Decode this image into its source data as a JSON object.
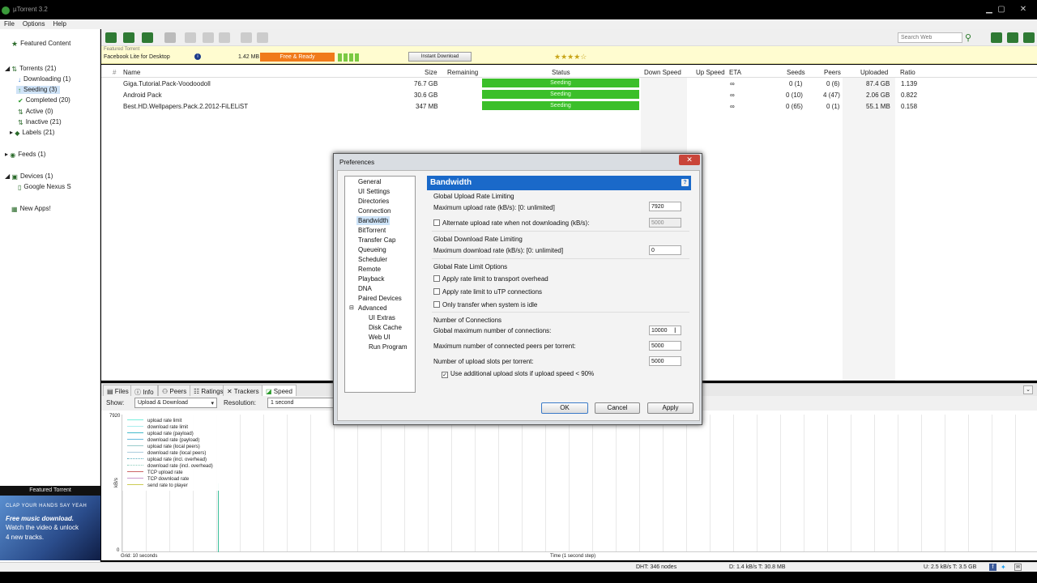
{
  "window": {
    "title": "µTorrent 3.2"
  },
  "menu": [
    "File",
    "Options",
    "Help"
  ],
  "sidebar": {
    "featured": "Featured Content",
    "torrents": "Torrents (21)",
    "items": [
      "Downloading (1)",
      "Seeding (3)",
      "Completed (20)",
      "Active (0)",
      "Inactive (21)",
      "Labels (21)"
    ],
    "feeds": "Feeds (1)",
    "devices": "Devices (1)",
    "device": "Google Nexus S",
    "apps": "New Apps!"
  },
  "toolbar": {
    "search_placeholder": "Search Web"
  },
  "featured": {
    "label": "Featured Torrent",
    "name": "Facebook Lite for Desktop",
    "size": "1.42 MB",
    "tag": "Free & Ready",
    "action": "Instant Download",
    "rating": "★★★★☆"
  },
  "columns": [
    "Name",
    "Size",
    "Remaining",
    "Status",
    "Down Speed",
    "Up Speed",
    "ETA",
    "Seeds",
    "Peers",
    "Uploaded",
    "Ratio"
  ],
  "torrents": [
    {
      "name": "Giga.Tutorial.Pack-Voodoodoll",
      "size": "76.7 GB",
      "status": "Seeding",
      "eta": "∞",
      "seeds": "0 (1)",
      "peers": "0 (6)",
      "uploaded": "87.4 GB",
      "ratio": "1.139"
    },
    {
      "name": "Android Pack",
      "size": "30.6 GB",
      "status": "Seeding",
      "eta": "∞",
      "seeds": "0 (10)",
      "peers": "4 (47)",
      "uploaded": "2.06 GB",
      "ratio": "0.822"
    },
    {
      "name": "Best.HD.Wellpapers.Pack.2.2012-FiLELiST",
      "size": "347 MB",
      "status": "Seeding",
      "eta": "∞",
      "seeds": "0 (65)",
      "peers": "0 (1)",
      "uploaded": "55.1 MB",
      "ratio": "0.158"
    }
  ],
  "bottom_tabs": [
    "Files",
    "Info",
    "Peers",
    "Ratings",
    "Trackers",
    "Speed"
  ],
  "speed": {
    "show_label": "Show:",
    "show_value": "Upload & Download",
    "res_label": "Resolution:",
    "res_value": "1 second",
    "ymax": "7920",
    "yzero": "0",
    "ylabel": "kB/s",
    "grid_label": "Grid: 10 seconds",
    "time_label": "Time (1 second step)",
    "legend": [
      "upload rate limit",
      "download rate limit",
      "upload rate (payload)",
      "download rate (payload)",
      "upload rate (local peers)",
      "download rate (local peers)",
      "upload rate (incl. overhead)",
      "download rate (incl. overhead)",
      "TCP upload rate",
      "TCP download rate",
      "send rate to player"
    ]
  },
  "featured_torrent": {
    "title": "Featured Torrent",
    "line1": "CLAP YOUR HANDS SAY YEAH",
    "line2": "Free music download.",
    "line3": "Watch the video & unlock",
    "line4": "4 new tracks."
  },
  "status": {
    "dht": "DHT: 346 nodes",
    "down": "D: 1.4 kB/s T: 30.8 MB",
    "up": "U: 2.5 kB/s T: 3.5 GB"
  },
  "dialog": {
    "title": "Preferences",
    "close": "✕",
    "tree": [
      "General",
      "UI Settings",
      "Directories",
      "Connection",
      "Bandwidth",
      "BitTorrent",
      "Transfer Cap",
      "Queueing",
      "Scheduler",
      "Remote",
      "Playback",
      "DNA",
      "Paired Devices",
      "Advanced"
    ],
    "tree_sub": [
      "UI Extras",
      "Disk Cache",
      "Web UI",
      "Run Program"
    ],
    "heading": "Bandwidth",
    "help": "?",
    "g_upload": "Global Upload Rate Limiting",
    "max_up_label": "Maximum upload rate (kB/s): [0: unlimited]",
    "max_up_value": "7920",
    "alt_up_label": "Alternate upload rate when not downloading (kB/s):",
    "alt_up_value": "5000",
    "g_download": "Global Download Rate Limiting",
    "max_down_label": "Maximum download rate (kB/s): [0: unlimited]",
    "max_down_value": "0",
    "g_opts": "Global Rate Limit Options",
    "opt1": "Apply rate limit to transport overhead",
    "opt2": "Apply rate limit to uTP connections",
    "opt3": "Only transfer when system is idle",
    "g_conn": "Number of Connections",
    "conn1_label": "Global maximum number of connections:",
    "conn1_value": "10000",
    "conn2_label": "Maximum number of connected peers per torrent:",
    "conn2_value": "5000",
    "conn3_label": "Number of upload slots per torrent:",
    "conn3_value": "5000",
    "extra_slots": "Use additional upload slots if upload speed < 90%",
    "ok": "OK",
    "cancel": "Cancel",
    "apply": "Apply"
  },
  "colors": {
    "seeding": "#3bbf2a",
    "accent": "#1a69c9",
    "tag": "#f07a1a"
  }
}
